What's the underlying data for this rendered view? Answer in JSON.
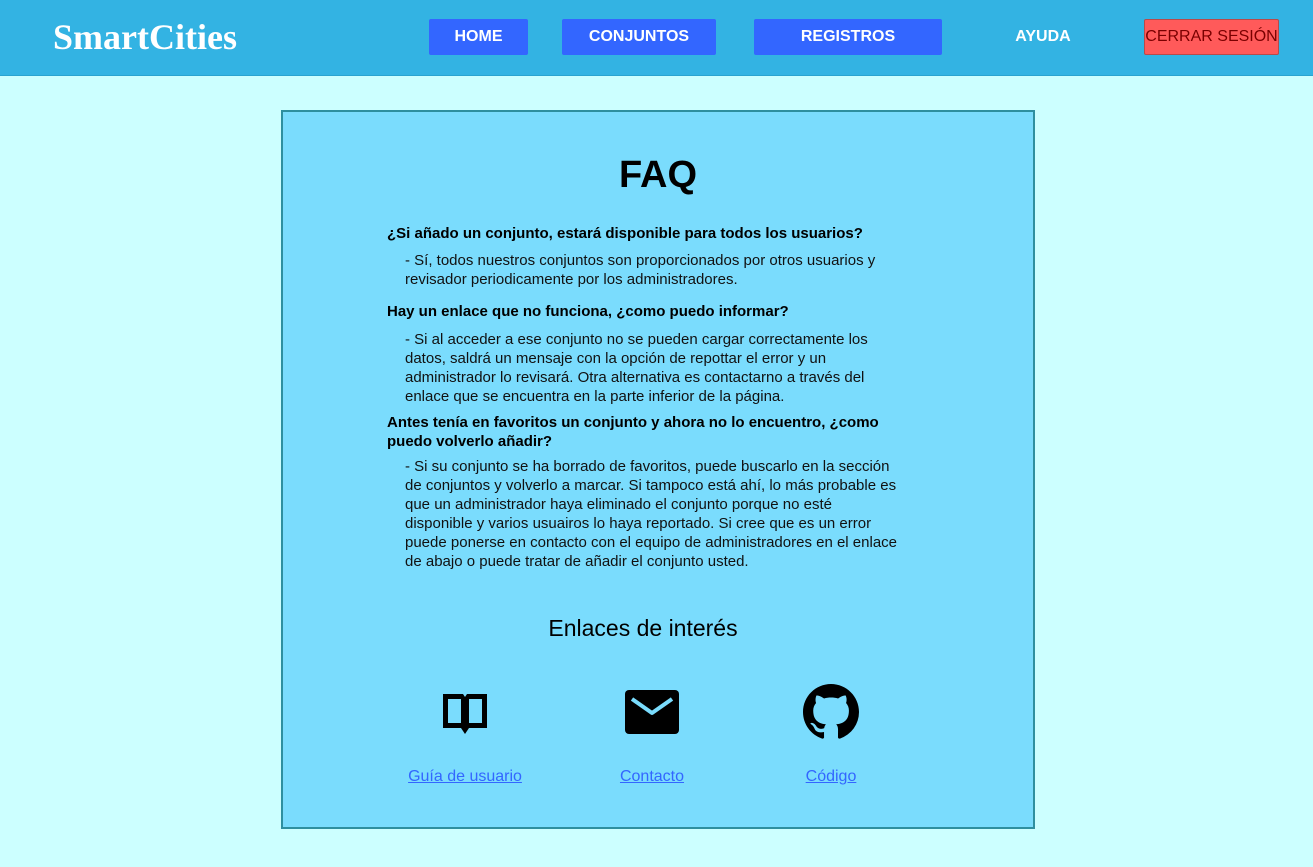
{
  "header": {
    "brand": "SmartCities",
    "nav": {
      "home": "HOME",
      "conjuntos": "CONJUNTOS",
      "registros": "REGISTROS",
      "ayuda": "AYUDA"
    },
    "logout": "CERRAR SESIÓN"
  },
  "faq": {
    "title": "FAQ",
    "items": [
      {
        "question": "¿Si añado un conjunto, estará disponible para todos los usuarios?",
        "answer": "- Sí, todos nuestros conjuntos son proporcionados por otros usuarios y revisador periodicamente por los administradores."
      },
      {
        "question": "Hay un enlace que no funciona, ¿como puedo informar?",
        "answer": "- Si al acceder a ese conjunto no se pueden cargar correctamente los datos, saldrá un mensaje con la opción de repottar el error y un administrador lo revisará. Otra alternativa es contactarno a través del enlace que se encuentra en la parte inferior de la página."
      },
      {
        "question": "Antes tenía en favoritos un conjunto y ahora no lo encuentro, ¿como puedo volverlo añadir?",
        "answer": "- Si su conjunto se ha borrado de favoritos, puede buscarlo en la sección de conjuntos y volverlo a marcar. Si tampoco está ahí, lo más probable es que un administrador haya eliminado el conjunto porque no esté disponible y varios usuairos lo haya reportado. Si cree que es un error puede ponerse en contacto con el equipo de administradores en el enlace de abajo o puede tratar de añadir el conjunto usted."
      }
    ]
  },
  "links": {
    "title": "Enlaces de interés",
    "items": [
      {
        "label": "Guía de usuario",
        "icon": "book-icon"
      },
      {
        "label": "Contacto",
        "icon": "mail-icon"
      },
      {
        "label": "Código",
        "icon": "github-icon"
      }
    ]
  },
  "colors": {
    "page_bg": "#ccffff",
    "navbar_bg": "#33b3e3",
    "nav_button": "#3366ff",
    "logout_button": "#ff5a5a",
    "card_bg": "#7adcfd",
    "link": "#3366ff"
  }
}
